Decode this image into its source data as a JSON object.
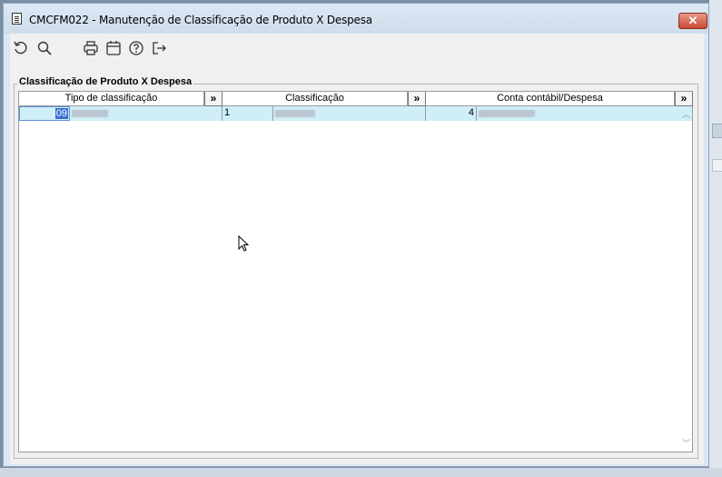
{
  "window": {
    "title": "CMCFM022 - Manutenção de Classificação de Produto X Despesa",
    "close_label": "✕"
  },
  "toolbar": {
    "buttons": [
      {
        "name": "refresh-icon"
      },
      {
        "name": "search-icon"
      },
      {
        "name": "print-icon"
      },
      {
        "name": "calendar-icon"
      },
      {
        "name": "help-icon"
      },
      {
        "name": "exit-icon"
      }
    ]
  },
  "group": {
    "title": "Classificação de Produto X Despesa"
  },
  "grid": {
    "headers": {
      "tipo": "Tipo de classificação",
      "classificacao": "Classificação",
      "conta": "Conta contábil/Despesa",
      "expand": "»"
    },
    "rows": [
      {
        "tipo_code": "09",
        "classificacao_code": "1",
        "conta_code": "4"
      }
    ]
  },
  "colors": {
    "row_highlight": "#cfeef8",
    "selection": "#3b6fd1",
    "title_bar": "#dde8f5",
    "close": "#c94a33"
  }
}
